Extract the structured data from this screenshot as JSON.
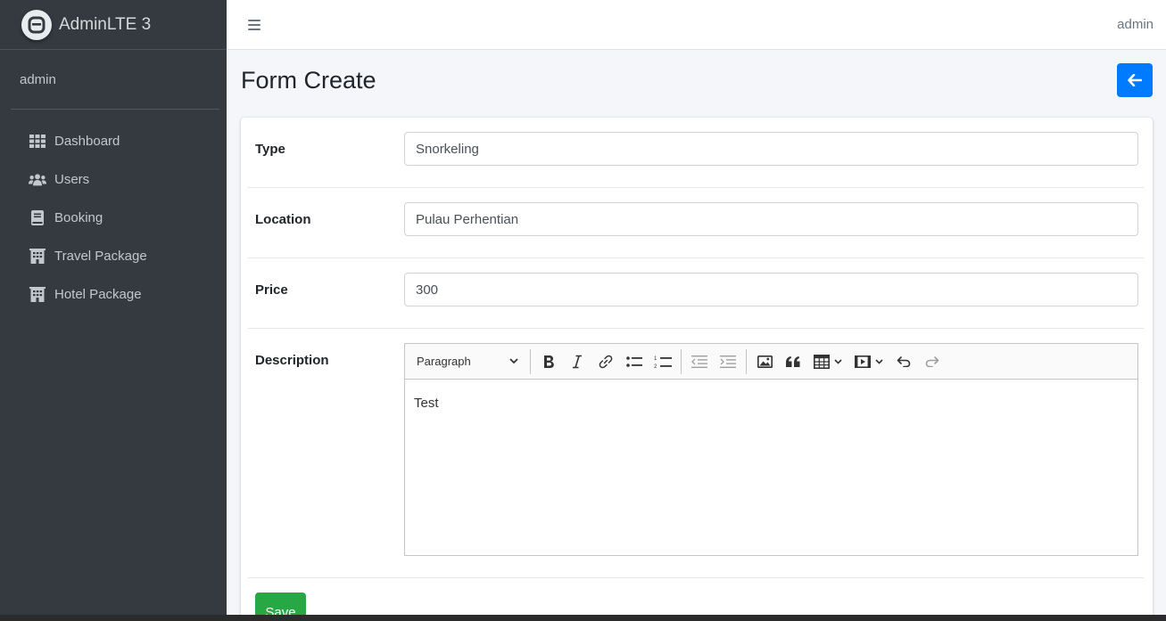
{
  "brand": {
    "name": "AdminLTE 3",
    "logo_letter": "A"
  },
  "sidebar": {
    "user": "admin",
    "items": [
      {
        "label": "Dashboard",
        "icon": "grid-icon"
      },
      {
        "label": "Users",
        "icon": "users-icon"
      },
      {
        "label": "Booking",
        "icon": "book-icon"
      },
      {
        "label": "Travel Package",
        "icon": "building-icon"
      },
      {
        "label": "Hotel Package",
        "icon": "building-icon"
      }
    ]
  },
  "navbar": {
    "user": "admin"
  },
  "page": {
    "title": "Form Create"
  },
  "form": {
    "type": {
      "label": "Type",
      "value": "Snorkeling"
    },
    "location": {
      "label": "Location",
      "value": "Pulau Perhentian"
    },
    "price": {
      "label": "Price",
      "value": "300"
    },
    "description": {
      "label": "Description",
      "heading_option": "Paragraph",
      "content": "Test"
    },
    "save_label": "Save"
  },
  "colors": {
    "sidebar_bg": "#343a40",
    "primary": "#007bff",
    "success": "#28a745"
  }
}
